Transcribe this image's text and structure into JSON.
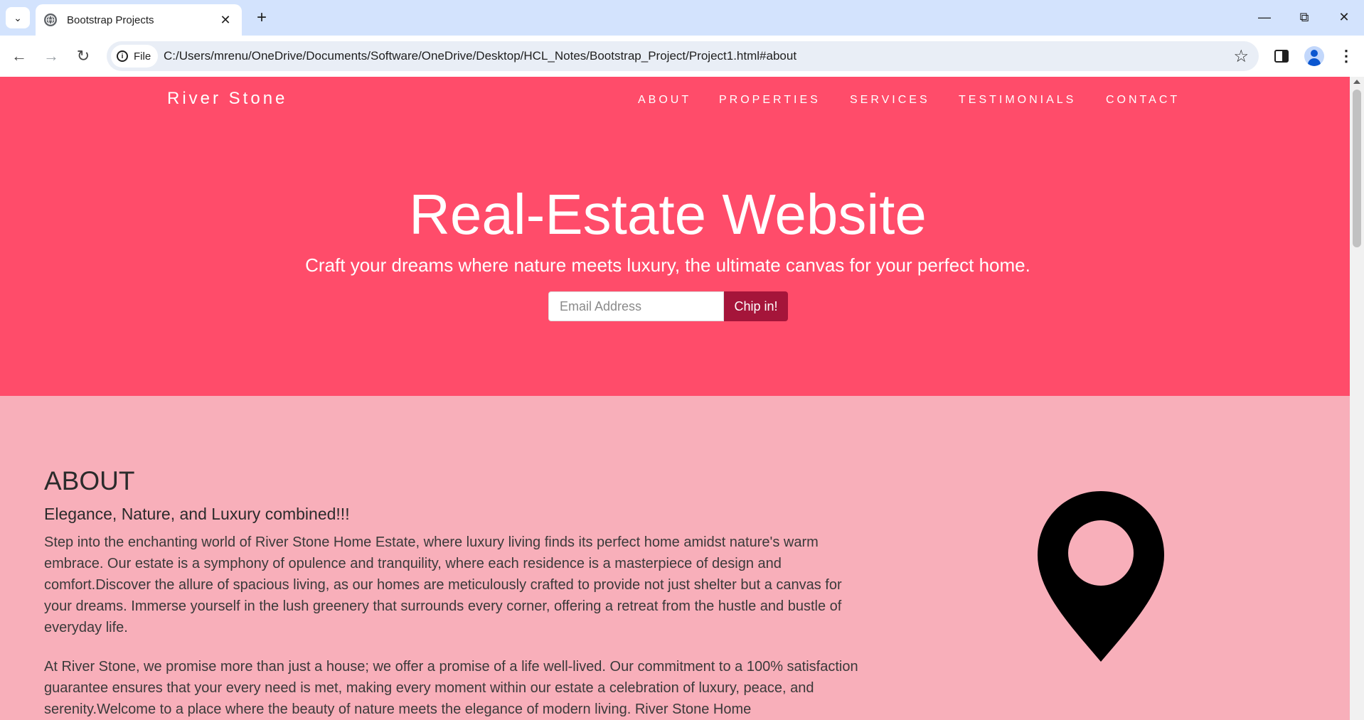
{
  "browser": {
    "tab_title": "Bootstrap Projects",
    "new_tab": "+",
    "file_chip": "File",
    "url": "C:/Users/mrenu/OneDrive/Documents/Software/OneDrive/Desktop/HCL_Notes/Bootstrap_Project/Project1.html#about"
  },
  "navbar": {
    "brand": "River Stone",
    "links": [
      "ABOUT",
      "PROPERTIES",
      "SERVICES",
      "TESTIMONIALS",
      "CONTACT"
    ]
  },
  "hero": {
    "title": "Real-Estate Website",
    "subtitle": "Craft your dreams where nature meets luxury, the ultimate canvas for your perfect home.",
    "email_placeholder": "Email Address",
    "button": "Chip in!"
  },
  "about": {
    "heading": "ABOUT",
    "subheading": "Elegance, Nature, and Luxury combined!!!",
    "paragraph1": "Step into the enchanting world of River Stone Home Estate, where luxury living finds its perfect home amidst nature's warm embrace. Our estate is a symphony of opulence and tranquility, where each residence is a masterpiece of design and comfort.Discover the allure of spacious living, as our homes are meticulously crafted to provide not just shelter but a canvas for your dreams. Immerse yourself in the lush greenery that surrounds every corner, offering a retreat from the hustle and bustle of everyday life.",
    "paragraph2": "At River Stone, we promise more than just a house; we offer a promise of a life well-lived. Our commitment to a 100% satisfaction guarantee ensures that your every need is met, making every moment within our estate a celebration of luxury, peace, and serenity.Welcome to a place where the beauty of nature meets the elegance of modern living. River Stone Home"
  },
  "colors": {
    "hero_bg": "#ff4c6a",
    "about_bg": "#f8afba",
    "button_bg": "#a5153a"
  }
}
